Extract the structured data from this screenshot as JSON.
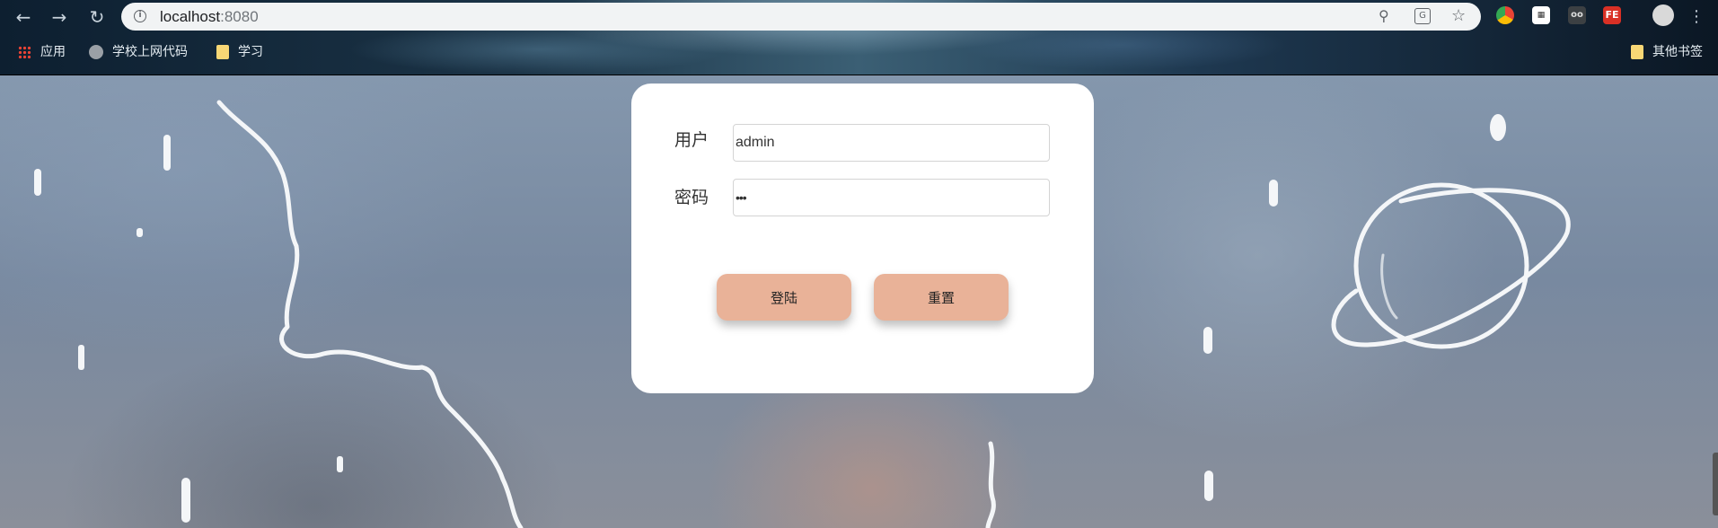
{
  "browser": {
    "url_host": "localhost",
    "url_port": ":8080",
    "bookmarks": [
      {
        "label": "应用",
        "icon": "apps-grid-icon"
      },
      {
        "label": "学校上网代码",
        "icon": "globe-icon"
      },
      {
        "label": "学习",
        "icon": "folder-icon"
      }
    ],
    "other_bookmarks": "其他书签",
    "extensions": [
      "FE"
    ]
  },
  "login": {
    "username_label": "用户",
    "username_value": "admin",
    "password_label": "密码",
    "password_value": "•••",
    "login_button": "登陆",
    "reset_button": "重置"
  },
  "colors": {
    "button_bg": "#e9b298",
    "card_bg": "#ffffff"
  }
}
